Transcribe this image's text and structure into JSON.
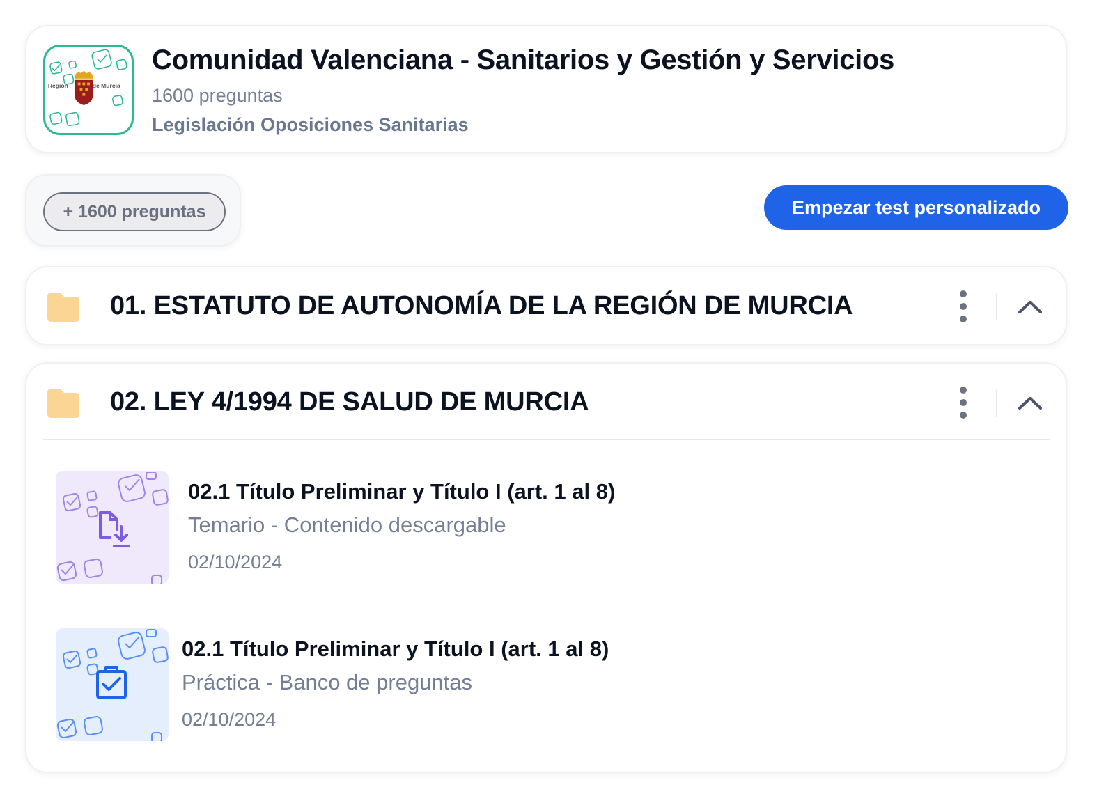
{
  "course": {
    "title": "Comunidad Valenciana - Sanitarios y Gestión y Servicios",
    "question_count": "1600 preguntas",
    "category": "Legislación Oposiciones Sanitarias",
    "logo": {
      "left_text": "Región",
      "right_text": "de Murcia"
    }
  },
  "filter": {
    "chip_label": "+ 1600 preguntas"
  },
  "actions": {
    "start_custom_test": "Empezar test personalizado"
  },
  "sections": [
    {
      "title": "01. ESTATUTO DE AUTONOMÍA DE LA REGIÓN DE MURCIA",
      "expanded": false,
      "icon": "folder-icon"
    },
    {
      "title": "02. LEY 4/1994 DE SALUD DE MURCIA",
      "expanded": true,
      "icon": "folder-icon",
      "items": [
        {
          "title": "02.1 Título Preliminar y Título I (art. 1 al 8)",
          "subtitle": "Temario - Contenido descargable",
          "date": "02/10/2024",
          "icon": "file-download-icon",
          "thumb_color": "#efe9fb"
        },
        {
          "title": "02.1 Título Preliminar y Título I (art. 1 al 8)",
          "subtitle": "Práctica - Banco de preguntas",
          "date": "02/10/2024",
          "icon": "clipboard-check-icon",
          "thumb_color": "#e4eefd"
        }
      ]
    }
  ],
  "colors": {
    "accent": "#1f63e8",
    "logo_border": "#2bb98f",
    "folder": "#fad594",
    "muted_text": "#737f94"
  }
}
